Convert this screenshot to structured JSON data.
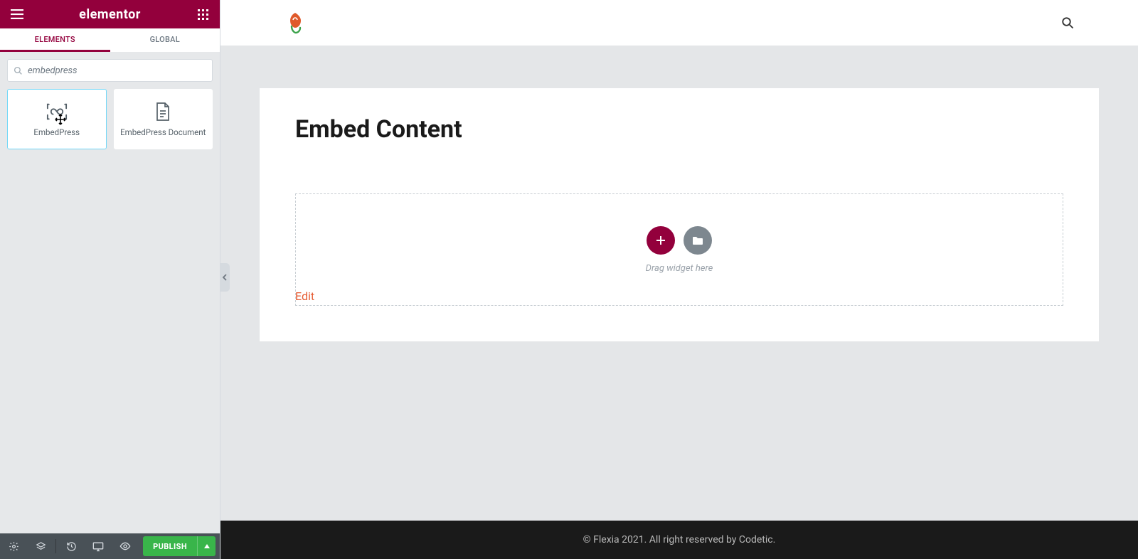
{
  "header": {
    "brand": "elementor"
  },
  "tabs": {
    "elements": "ELEMENTS",
    "global": "GLOBAL"
  },
  "search": {
    "value": "embedpress"
  },
  "widgets": [
    {
      "label": "EmbedPress"
    },
    {
      "label": "EmbedPress Document"
    }
  ],
  "bottom": {
    "publish": "PUBLISH"
  },
  "page": {
    "title": "Embed Content",
    "drop_hint": "Drag widget here",
    "edit": "Edit"
  },
  "footer": {
    "text": "© Flexia 2021. All right reserved by Codetic."
  }
}
